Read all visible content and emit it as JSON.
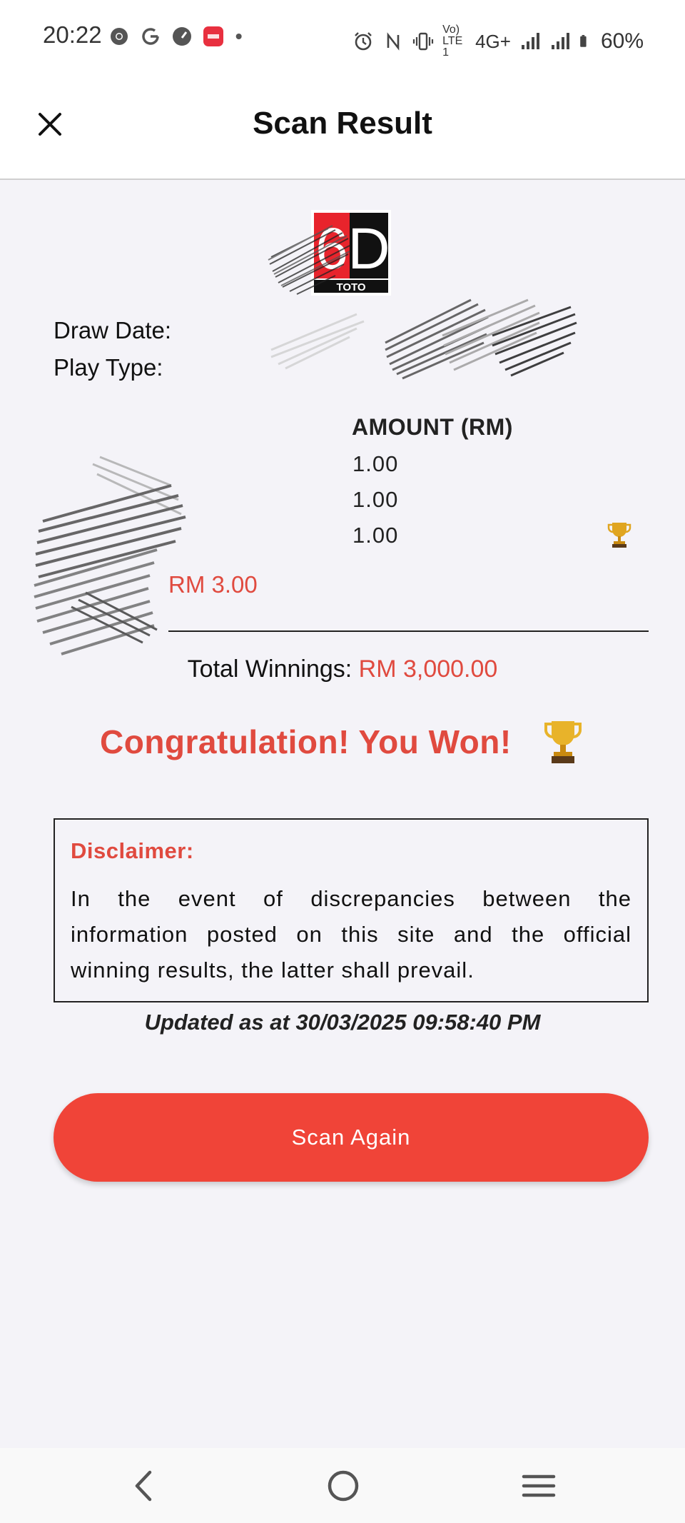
{
  "status_bar": {
    "time": "20:22",
    "network": "4G+",
    "volte": "Vo) LTE1",
    "battery": "60%",
    "icons": [
      "chrome-icon",
      "google-icon",
      "speedometer-icon",
      "app-badge-icon",
      "dot-icon",
      "alarm-icon",
      "nfc-icon",
      "vibrate-icon",
      "volte-icon",
      "signal-icon",
      "signal-icon",
      "battery-icon"
    ]
  },
  "header": {
    "title": "Scan Result",
    "close_icon": "close-icon"
  },
  "logo": {
    "brand": "6D",
    "sub": "TOTO"
  },
  "ticket": {
    "draw_date_label": "Draw Date:",
    "play_type_label": "Play Type:",
    "amount_header": "AMOUNT (RM)",
    "amounts": [
      "1.00",
      "1.00",
      "1.00"
    ],
    "winning_row_index": 2,
    "total_bet_value": "RM 3.00"
  },
  "result": {
    "total_winnings_label": "Total Winnings:",
    "total_winnings_value": "RM 3,000.00",
    "congrats": "Congratulation! You Won!"
  },
  "disclaimer": {
    "title": "Disclaimer:",
    "body": "In the event of discrepancies between the information posted on this site and the official winning results, the latter shall prevail."
  },
  "updated": "Updated as at 30/03/2025 09:58:40 PM",
  "actions": {
    "scan_again": "Scan Again"
  },
  "colors": {
    "accent_red": "#e04a3f",
    "button_red": "#f04438",
    "background": "#f4f3f8",
    "gold": "#e0a520"
  }
}
